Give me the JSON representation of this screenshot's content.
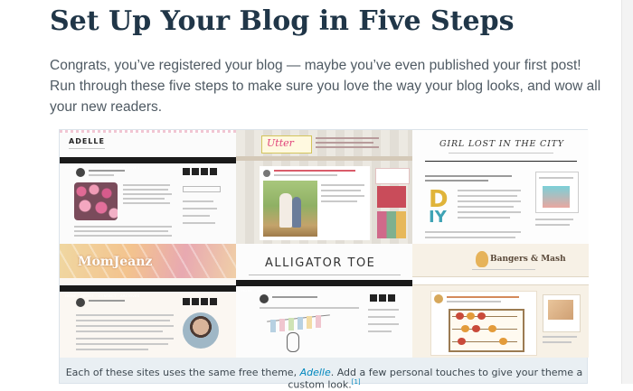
{
  "article": {
    "title": "Set Up Your Blog in Five Steps",
    "intro": "Congrats, you’ve registered your blog — maybe you’ve even published your first post! Run through these five steps to make sure you love the way your blog looks, and wow all your new readers."
  },
  "figure": {
    "caption_before": "Each of these sites uses the same free theme, ",
    "theme_link": "Adelle",
    "caption_after": ". Add a few personal touches to give your theme a custom look.",
    "footnote": "[1]",
    "sites": [
      {
        "name": "ADELLE"
      },
      {
        "name": "Utter"
      },
      {
        "name": "GIRL LOST IN THE CITY"
      },
      {
        "name": "MomJeanz"
      },
      {
        "name": "ALLIGATOR TOE"
      },
      {
        "name": "Bangers & Mash"
      }
    ]
  },
  "colors": {
    "title": "#203648",
    "body_text": "#4f5a63",
    "link": "#0087be",
    "figure_bg": "#e9eff3"
  }
}
